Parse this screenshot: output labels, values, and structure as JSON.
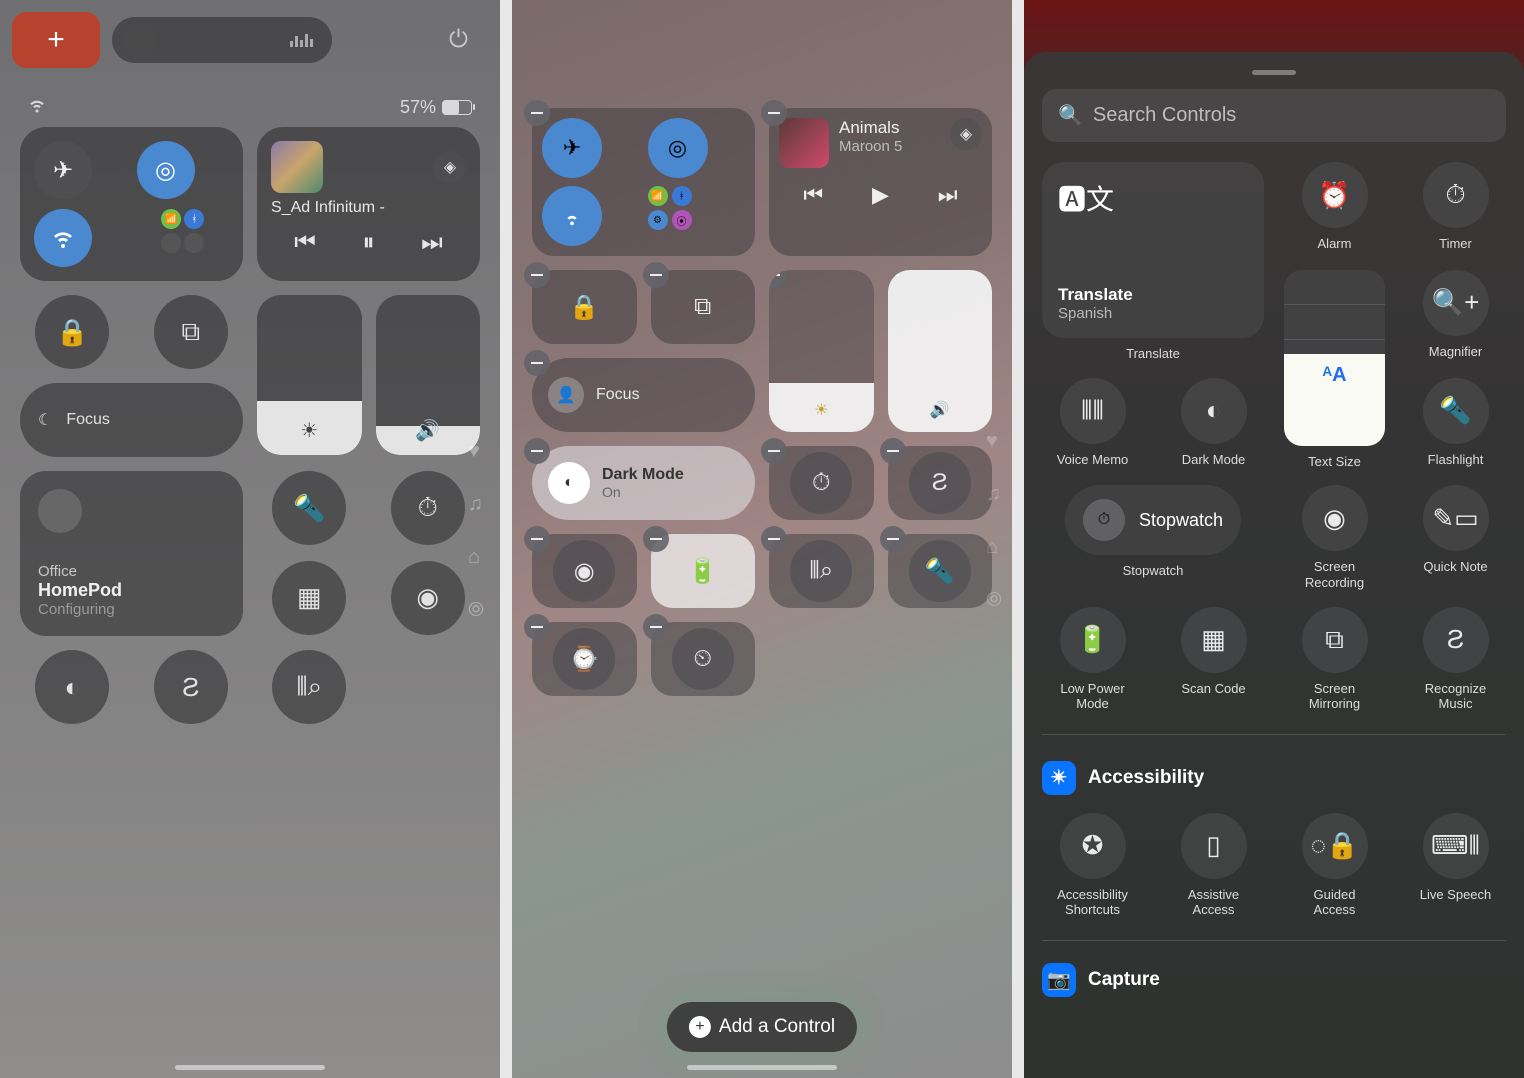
{
  "panel1": {
    "battery_pct": "57%",
    "track": "S_Ad Infinitum -",
    "focus_label": "Focus",
    "home": {
      "room": "Office",
      "device": "HomePod",
      "status": "Configuring"
    }
  },
  "panel2": {
    "song": "Animals",
    "artist": "Maroon 5",
    "focus_label": "Focus",
    "dark_mode_label": "Dark Mode",
    "dark_mode_state": "On",
    "add_control": "Add a Control"
  },
  "panel3": {
    "search_placeholder": "Search Controls",
    "translate_card": {
      "title": "Translate",
      "subtitle": "Spanish",
      "label": "Translate"
    },
    "items": {
      "alarm": "Alarm",
      "timer": "Timer",
      "magnifier": "Magnifier",
      "voice_memo": "Voice Memo",
      "dark_mode": "Dark Mode",
      "text_size": "Text Size",
      "flashlight": "Flashlight",
      "stopwatch": "Stopwatch",
      "stopwatch_label": "Stopwatch",
      "screen_recording": "Screen\nRecording",
      "quick_note": "Quick Note",
      "low_power": "Low Power\nMode",
      "scan_code": "Scan Code",
      "screen_mirroring": "Screen\nMirroring",
      "recognize_music": "Recognize\nMusic"
    },
    "section_accessibility": "Accessibility",
    "acc_items": {
      "shortcuts": "Accessibility\nShortcuts",
      "assistive": "Assistive\nAccess",
      "guided": "Guided\nAccess",
      "live_speech": "Live Speech"
    },
    "section_capture": "Capture"
  }
}
